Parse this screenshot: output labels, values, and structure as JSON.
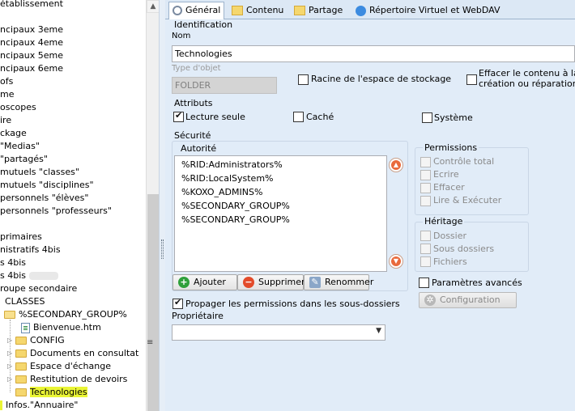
{
  "tree": {
    "rows": [
      "établissement",
      "ncipaux 3eme",
      "ncipaux 4eme",
      "ncipaux 5eme",
      "ncipaux 6eme",
      "ofs",
      "me",
      "oscopes",
      "ire",
      "ckage",
      "\"Medias\"",
      "\"partagés\"",
      "mutuels \"classes\"",
      "mutuels \"disciplines\"",
      "personnels \"élèves\"",
      "personnels \"professeurs\"",
      "primaires",
      "nistratifs 4bis",
      "s 4bis",
      "s 4bis",
      "roupe secondaire",
      "CLASSES",
      "%SECONDARY_GROUP%",
      "Bienvenue.htm",
      "CONFIG",
      "Documents en consultat",
      "Espace d'échange",
      "Restitution de devoirs",
      "Technologies",
      "Infos.\"Annuaire\""
    ]
  },
  "tabs": [
    {
      "label": "Général",
      "icon": "gear-icon"
    },
    {
      "label": "Contenu",
      "icon": "folder-icon"
    },
    {
      "label": "Partage",
      "icon": "shared-folder-icon"
    },
    {
      "label": "Répertoire Virtuel et WebDAV",
      "icon": "ie-icon"
    }
  ],
  "identification": {
    "title": "Identification",
    "nom_label": "Nom",
    "nom_value": "Technologies",
    "type_label": "Type d'objet",
    "type_value": "FOLDER",
    "racine_label": "Racine de l'espace de stockage",
    "effacer_label_1": "Effacer le contenu à la",
    "effacer_label_2": "création ou réparation"
  },
  "attributs": {
    "title": "Attributs",
    "lecture_seule": "Lecture seule",
    "cache": "Caché",
    "systeme": "Système"
  },
  "securite": {
    "title": "Sécurité",
    "autorite_label": "Autorité",
    "entries": [
      "%RID:Administrators%",
      "%RID:LocalSystem%",
      "%KOXO_ADMINS%",
      "%SECONDARY_GROUP%",
      "%SECONDARY_GROUP%"
    ],
    "btn_ajouter": "Ajouter",
    "btn_supprimer": "Supprimer",
    "btn_renommer": "Renommer",
    "propager_label": "Propager les permissions dans les sous-dossiers",
    "proprietaire_label": "Propriétaire",
    "proprietaire_value": ""
  },
  "permissions": {
    "title": "Permissions",
    "items": [
      "Contrôle total",
      "Ecrire",
      "Effacer",
      "Lire & Exécuter"
    ]
  },
  "heritage": {
    "title": "Héritage",
    "items": [
      "Dossier",
      "Sous dossiers",
      "Fichiers"
    ]
  },
  "avances": {
    "label": "Paramètres avancés",
    "configuration": "Configuration"
  },
  "colors": {
    "highlight": "#eaf535",
    "panel_bg": "#e1ecf8",
    "remove_red": "#e34b2a",
    "add_green": "#2fa03b"
  }
}
